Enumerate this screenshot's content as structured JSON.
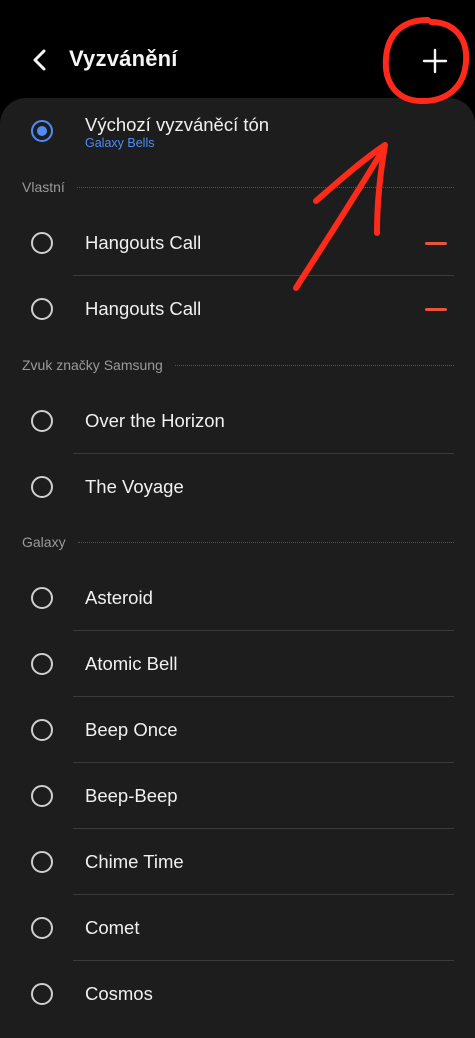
{
  "header": {
    "title": "Vyzvánění"
  },
  "default_tone": {
    "label": "Výchozí vyzváněcí tón",
    "value": "Galaxy Bells",
    "selected": true
  },
  "sections": {
    "custom": {
      "title": "Vlastní",
      "items": [
        {
          "label": "Hangouts Call"
        },
        {
          "label": "Hangouts Call"
        }
      ]
    },
    "samsung": {
      "title": "Zvuk značky Samsung",
      "items": [
        {
          "label": "Over the Horizon"
        },
        {
          "label": "The Voyage"
        }
      ]
    },
    "galaxy": {
      "title": "Galaxy",
      "items": [
        {
          "label": "Asteroid"
        },
        {
          "label": "Atomic Bell"
        },
        {
          "label": "Beep Once"
        },
        {
          "label": "Beep-Beep"
        },
        {
          "label": "Chime Time"
        },
        {
          "label": "Comet"
        },
        {
          "label": "Cosmos"
        }
      ]
    }
  },
  "colors": {
    "accent": "#4f8df5",
    "remove": "#e8533a",
    "annotation": "#ff2a1a",
    "background": "#000000",
    "card": "#1d1d1d"
  },
  "icons": {
    "back": "chevron-left-icon",
    "add": "plus-icon",
    "remove": "minus-icon"
  }
}
